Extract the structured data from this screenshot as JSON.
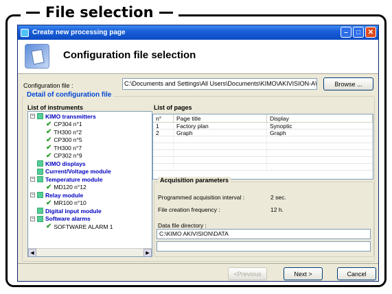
{
  "frame_title": "File selection",
  "window": {
    "title": "Create new processing page"
  },
  "header": {
    "title": "Configuration file selection"
  },
  "config": {
    "label": "Configuration file :",
    "value": "C:\\Documents and Settings\\All Users\\Documents\\KIMO\\AKIVISION-A\\Visual",
    "browse_label": "Browse ..."
  },
  "detail": {
    "legend": "Detail of configuration file"
  },
  "instruments": {
    "label": "List of instruments",
    "items": [
      {
        "text": "KIMO transmitters",
        "group": true,
        "expander": "−"
      },
      {
        "text": "CP304 n°1"
      },
      {
        "text": "TH300 n°2"
      },
      {
        "text": "CP300 n°5"
      },
      {
        "text": "TH300 n°7"
      },
      {
        "text": "CP302 n°9"
      },
      {
        "text": "KIMO displays",
        "group": true
      },
      {
        "text": "Current/Voltage module",
        "group": true
      },
      {
        "text": "Temperature module",
        "group": true,
        "expander": "−"
      },
      {
        "text": "MD120 n°12"
      },
      {
        "text": "Relay module",
        "group": true,
        "expander": "−"
      },
      {
        "text": "MR100 n°10"
      },
      {
        "text": "Digital input module",
        "group": true
      },
      {
        "text": "Software alarms",
        "group": true,
        "expander": "−"
      },
      {
        "text": "SOFTWARE ALARM 1"
      }
    ]
  },
  "pages": {
    "label": "List of pages",
    "headers": [
      "n°",
      "Page title",
      "Display"
    ],
    "rows": [
      [
        "1",
        "Factory plan",
        "Synoptic"
      ],
      [
        "2",
        "Graph",
        "Graph"
      ]
    ]
  },
  "acquisition": {
    "legend": "Acquisition parameters",
    "interval_label": "Programmed acquisition interval :",
    "interval_value": "2 sec.",
    "frequency_label": "File creation frequency :",
    "frequency_value": "12 h.",
    "dir_label": "Data file directory :",
    "dir_value": "C:\\KIMO AKIVISION\\DATA"
  },
  "nav": {
    "previous": "<Previous",
    "next": "Next >",
    "cancel": "Cancel"
  },
  "colors": {
    "accent": "#0046d5",
    "title_bar": "#0c4bc3",
    "group_text": "#0000c0",
    "check": "#2a9a2a"
  }
}
